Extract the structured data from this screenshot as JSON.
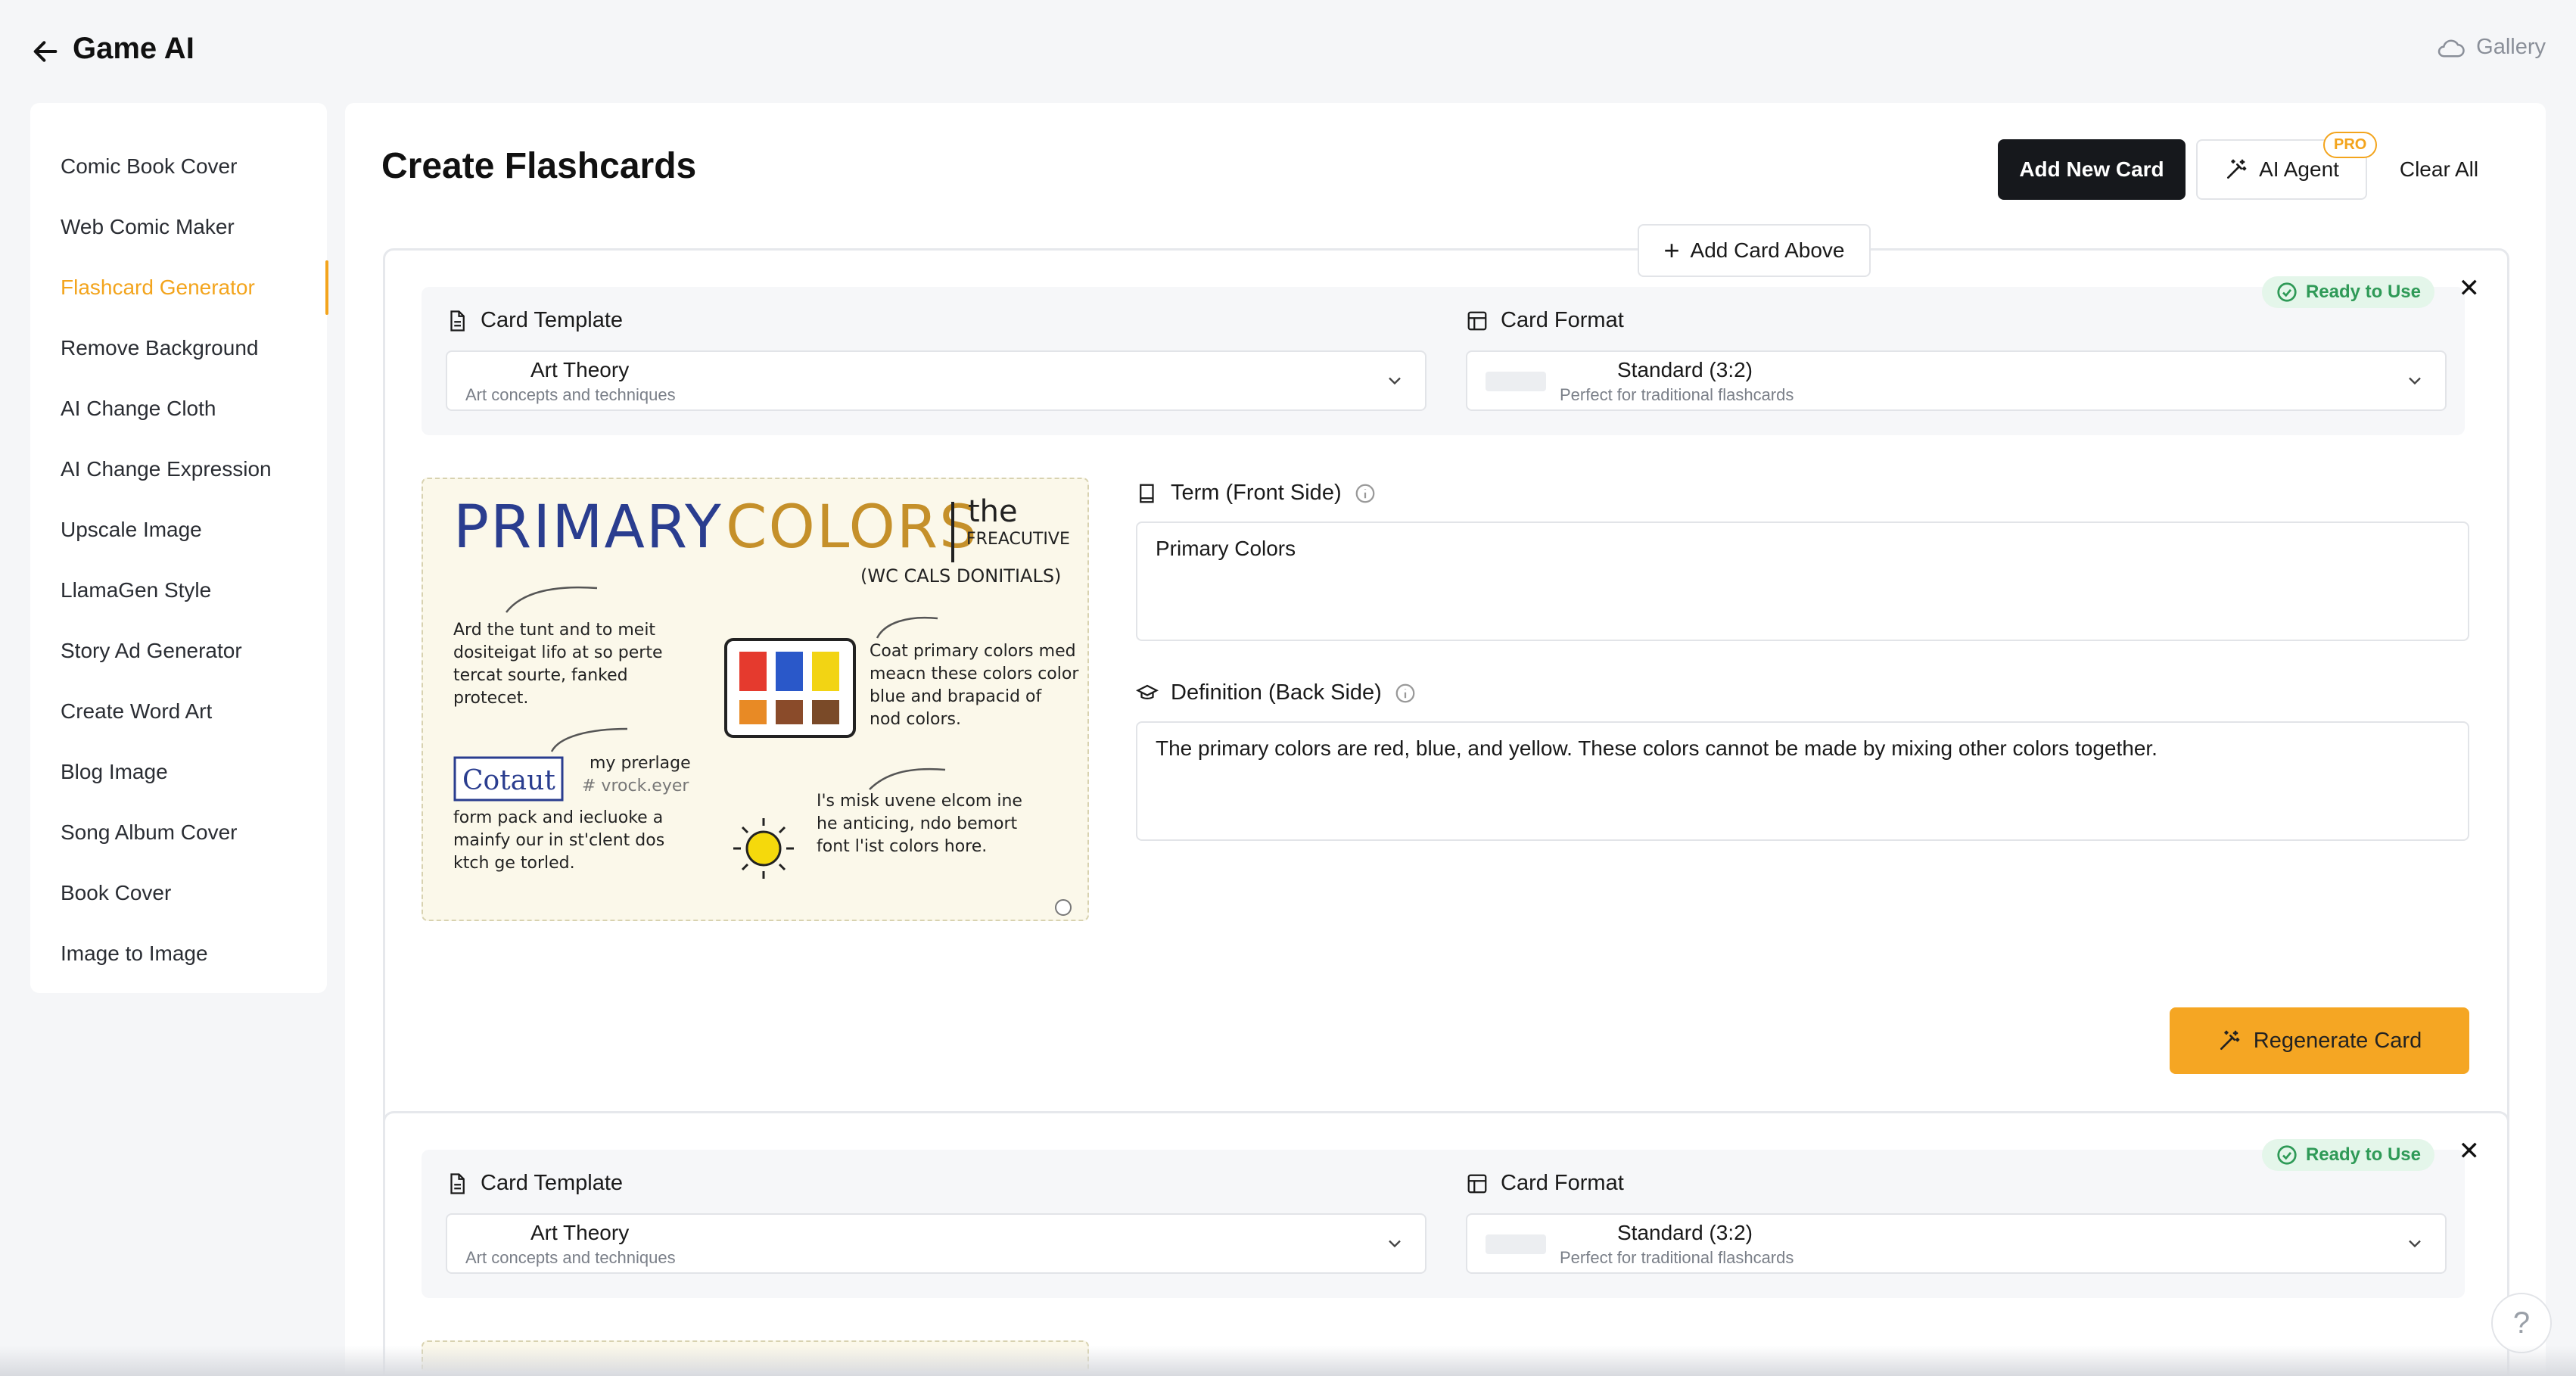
{
  "app": {
    "title": "Game AI",
    "gallery_label": "Gallery"
  },
  "sidebar": {
    "items": [
      {
        "label": "Comic Book Cover",
        "active": false
      },
      {
        "label": "Web Comic Maker",
        "active": false
      },
      {
        "label": "Flashcard Generator",
        "active": true
      },
      {
        "label": "Remove Background",
        "active": false
      },
      {
        "label": "AI Change Cloth",
        "active": false
      },
      {
        "label": "AI Change Expression",
        "active": false
      },
      {
        "label": "Upscale Image",
        "active": false
      },
      {
        "label": "LlamaGen Style",
        "active": false
      },
      {
        "label": "Story Ad Generator",
        "active": false
      },
      {
        "label": "Create Word Art",
        "active": false
      },
      {
        "label": "Blog Image",
        "active": false
      },
      {
        "label": "Song Album Cover",
        "active": false
      },
      {
        "label": "Book Cover",
        "active": false
      },
      {
        "label": "Image to Image",
        "active": false
      }
    ]
  },
  "main": {
    "title": "Create Flashcards",
    "buttons": {
      "add_new": "Add New Card",
      "ai_agent": "AI Agent",
      "pro": "PRO",
      "clear_all": "Clear All"
    },
    "add_above": "Add Card Above"
  },
  "cards": [
    {
      "status": "Ready to Use",
      "template_label": "Card Template",
      "template_value": "Art Theory",
      "template_desc": "Art concepts and techniques",
      "format_label": "Card Format",
      "format_value": "Standard (3:2)",
      "format_desc": "Perfect for traditional flashcards",
      "term_label": "Term (Front Side)",
      "term_value": "Primary Colors",
      "definition_label": "Definition (Back Side)",
      "definition_value": "The primary colors are red, blue, and yellow. These colors cannot be made by mixing other colors together.",
      "regenerate": "Regenerate Card",
      "image": {
        "heading_primary": "PRIMARY",
        "heading_colors": "COLORS",
        "heading_the": "the",
        "heading_sub": "FREACUTIVE",
        "subtitle": "(WC CALS DONITIALS)",
        "note1": [
          "Ard the tunt and to meit",
          "dositeigat lifo at so perte",
          "tercat sourte, fanked",
          "protecet."
        ],
        "note2": [
          "Coat primary colors med",
          "meacn these colors color",
          "blue and brapacid of",
          "nod colors."
        ],
        "cotaut": "Cotaut",
        "note3a": "my prerlage",
        "note3b": "# vrock.eyer",
        "note4": [
          "form pack and iecluoke a",
          "mainfy our in st'clent dos",
          "ktch ge torled."
        ],
        "note5": [
          "I's misk uvene elcom ine",
          "he anticing, ndo bemort",
          "font l'ist colors hore."
        ]
      }
    },
    {
      "status": "Ready to Use",
      "template_label": "Card Template",
      "template_value": "Art Theory",
      "template_desc": "Art concepts and techniques",
      "format_label": "Card Format",
      "format_value": "Standard (3:2)",
      "format_desc": "Perfect for traditional flashcards"
    }
  ],
  "help": "?",
  "colors": {
    "accent": "#f3a41c",
    "primary_dark": "#16181c",
    "ready_green": "#2f9a57",
    "regen_bg": "#f5a623"
  }
}
